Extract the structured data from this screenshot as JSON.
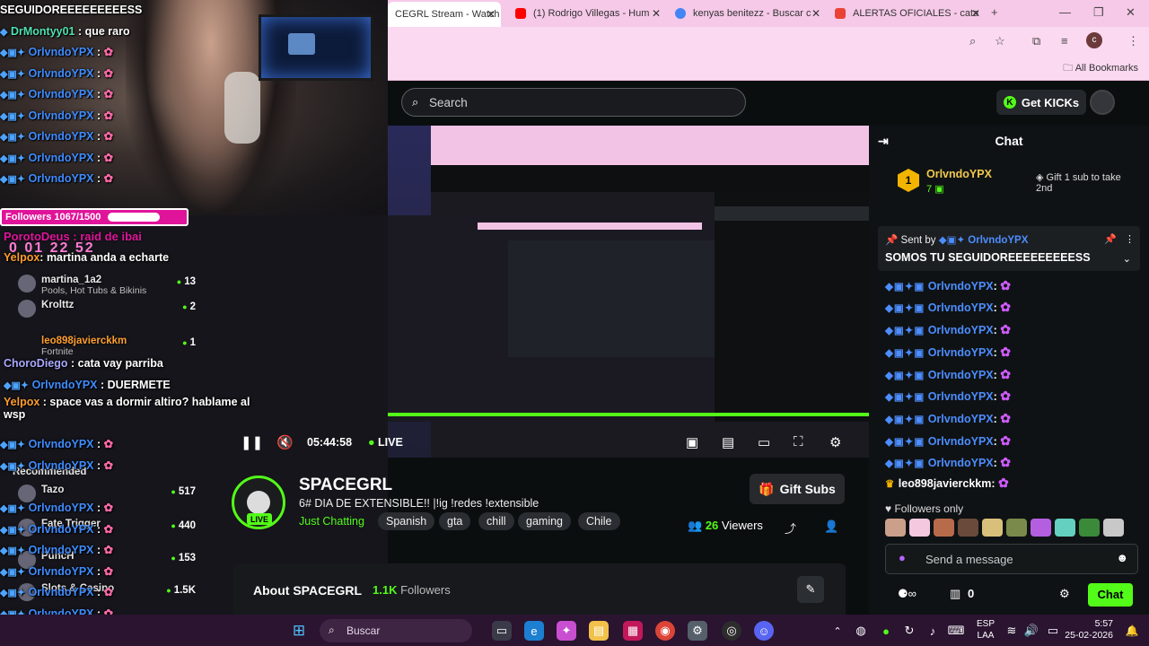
{
  "overlay": {
    "top_text": "SEGUIDOREEEEEEEEESS",
    "top_user": "DrMontyy01",
    "top_msg": "que raro",
    "repeat_user": "OrlvndoYPX",
    "followers_label": "Followers 1067/1500",
    "followers_progress": 0.711,
    "timer_label": "PorotoDeus : raid de ibai",
    "timer_digits": "0  01  22  52",
    "messages": [
      {
        "user": "Yelpox",
        "text": "martina anda a echarte"
      },
      {
        "user": "martina_1a2",
        "text": ""
      },
      {
        "user": "Krolttz",
        "text": ""
      },
      {
        "user": "martina_1a2",
        "text": ""
      },
      {
        "user": "leo898javierckkm",
        "text": ""
      },
      {
        "user": "ChoroDiego",
        "text": "cata vay parriba"
      },
      {
        "user": "OrlvndoYPX",
        "text": "DUERMETE"
      },
      {
        "user": "Yelpox",
        "text": "space vas a dormir altiro? hablame al wsp"
      }
    ],
    "bottom_user": "leo898javierckkm",
    "recommended_label": "Recommended",
    "recommended": [
      {
        "name": "martina_1a2",
        "category": "Pools, Hot Tubs & Bikinis",
        "viewers": "13"
      },
      {
        "name": "Krolttz",
        "category": "",
        "viewers": "2"
      },
      {
        "name": "leo898javierckkm",
        "category": "Fortnite",
        "viewers": "1"
      },
      {
        "name": "Tazo",
        "category": "",
        "viewers": "517"
      },
      {
        "name": "Fate Trigger",
        "category": "",
        "viewers": "440"
      },
      {
        "name": "PuncH",
        "category": "",
        "viewers": "153"
      },
      {
        "name": "Slots & Casino",
        "category": "",
        "viewers": "1.5K"
      }
    ]
  },
  "browser": {
    "tabs": [
      {
        "title": "CEGRL Stream - Watch",
        "color": "#53fc18"
      },
      {
        "title": "(1) Rodrigo Villegas - Hum",
        "color": "#ff0000"
      },
      {
        "title": "kenyas benitezz - Buscar c",
        "color": "#4285f4"
      },
      {
        "title": "ALERTAS OFICIALES - cata",
        "color": "#ea4335"
      }
    ],
    "all_bookmarks": "All Bookmarks",
    "new_tab": "+"
  },
  "kick": {
    "search_placeholder": "Search",
    "get_kicks": "Get KICKs",
    "time": "05:44:58",
    "live": "LIVE",
    "channel": {
      "name": "SPACEGRL",
      "title": "6#  DIA DE EXTENSIBLE!! |!ig !redes !extensible",
      "category": "Just Chatting",
      "tags": [
        "Spanish",
        "gta",
        "chill",
        "gaming",
        "Chile"
      ],
      "viewers": "26",
      "viewers_label": "Viewers",
      "gift_subs": "Gift Subs",
      "live_badge": "LIVE"
    },
    "about": {
      "title": "About SPACEGRL",
      "followers": "1.1K",
      "followers_label": "Followers"
    }
  },
  "chat": {
    "title": "Chat",
    "top_gifter": {
      "rank": "1",
      "name": "OrlvndoYPX",
      "count": "7"
    },
    "gift_prompt": "Gift 1 sub to take 2nd",
    "pinned_by_label": "Sent by",
    "pinned_user": "OrlvndoYPX",
    "pinned_msg": "SOMOS TU SEGUIDOREEEEEEEEESS",
    "messages": [
      {
        "user": "OrlvndoYPX"
      },
      {
        "user": "OrlvndoYPX"
      },
      {
        "user": "OrlvndoYPX"
      },
      {
        "user": "OrlvndoYPX"
      },
      {
        "user": "OrlvndoYPX"
      },
      {
        "user": "OrlvndoYPX"
      },
      {
        "user": "OrlvndoYPX"
      },
      {
        "user": "OrlvndoYPX"
      },
      {
        "user": "OrlvndoYPX"
      }
    ],
    "last_user": "leo898javierckkm",
    "followers_only": "Followers only",
    "send_placeholder": "Send a message",
    "kicks_balance": "0",
    "chat_button": "Chat"
  },
  "taskbar": {
    "search": "Buscar",
    "lang1": "ESP",
    "lang2": "LAA",
    "time": "5:57",
    "date": "25-02-2026"
  }
}
